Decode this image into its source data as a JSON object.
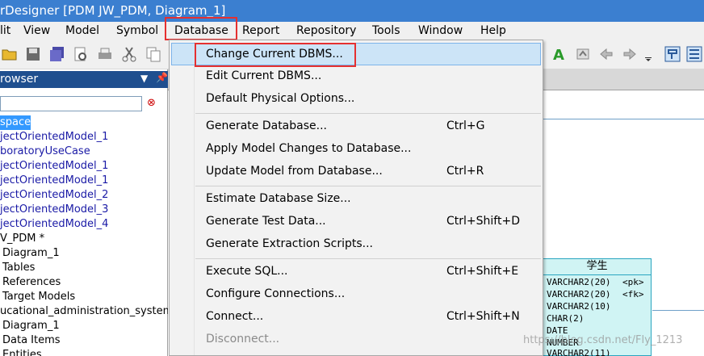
{
  "window": {
    "title": "rDesigner [PDM JW_PDM, Diagram_1]"
  },
  "menubar": {
    "items": [
      "lit",
      "View",
      "Model",
      "Symbol",
      "Database",
      "Report",
      "Repository",
      "Tools",
      "Window",
      "Help"
    ]
  },
  "browser": {
    "title": "rowser",
    "tree": [
      "space",
      "jectOrientedModel_1",
      "boratoryUseCase",
      "jectOrientedModel_1",
      "jectOrientedModel_1",
      "jectOrientedModel_2",
      "jectOrientedModel_3",
      "jectOrientedModel_4",
      "V_PDM *",
      "Diagram_1",
      "Tables",
      "References",
      "Target Models",
      "ucational_administration_system *",
      "Diagram_1",
      "Data Items",
      "Entities"
    ]
  },
  "database_menu": {
    "items": [
      {
        "label": "Change Current DBMS...",
        "shortcut": ""
      },
      {
        "label": "Edit Current DBMS...",
        "shortcut": ""
      },
      {
        "label": "Default Physical Options...",
        "shortcut": ""
      },
      {
        "label": "Generate Database...",
        "shortcut": "Ctrl+G"
      },
      {
        "label": "Apply Model Changes to Database...",
        "shortcut": ""
      },
      {
        "label": "Update Model from Database...",
        "shortcut": "Ctrl+R"
      },
      {
        "label": "Estimate Database Size...",
        "shortcut": ""
      },
      {
        "label": "Generate Test Data...",
        "shortcut": "Ctrl+Shift+D"
      },
      {
        "label": "Generate Extraction Scripts...",
        "shortcut": ""
      },
      {
        "label": "Execute SQL...",
        "shortcut": "Ctrl+Shift+E"
      },
      {
        "label": "Configure Connections...",
        "shortcut": ""
      },
      {
        "label": "Connect...",
        "shortcut": "Ctrl+Shift+N"
      },
      {
        "label": "Disconnect...",
        "shortcut": ""
      }
    ]
  },
  "entity": {
    "title": "学生",
    "columns": [
      {
        "type": "VARCHAR2(20)",
        "key": "<pk>"
      },
      {
        "type": "VARCHAR2(20)",
        "key": "<fk>"
      },
      {
        "type": "VARCHAR2(10)",
        "key": ""
      },
      {
        "type": "CHAR(2)",
        "key": ""
      },
      {
        "type": "DATE",
        "key": ""
      },
      {
        "type": "NUMBER",
        "key": ""
      },
      {
        "type": "VARCHAR2(11)",
        "key": ""
      }
    ]
  },
  "watermark": "https://blog.csdn.net/Fly_1213",
  "colors": {
    "titlebar": "#3b7fd0",
    "menu_background": "#f2f2f2",
    "menu_highlight": "#cce4f7",
    "annotation_red": "#e53030",
    "entity_fill": "#d0f4f4",
    "tree_selection": "#3399ff"
  }
}
